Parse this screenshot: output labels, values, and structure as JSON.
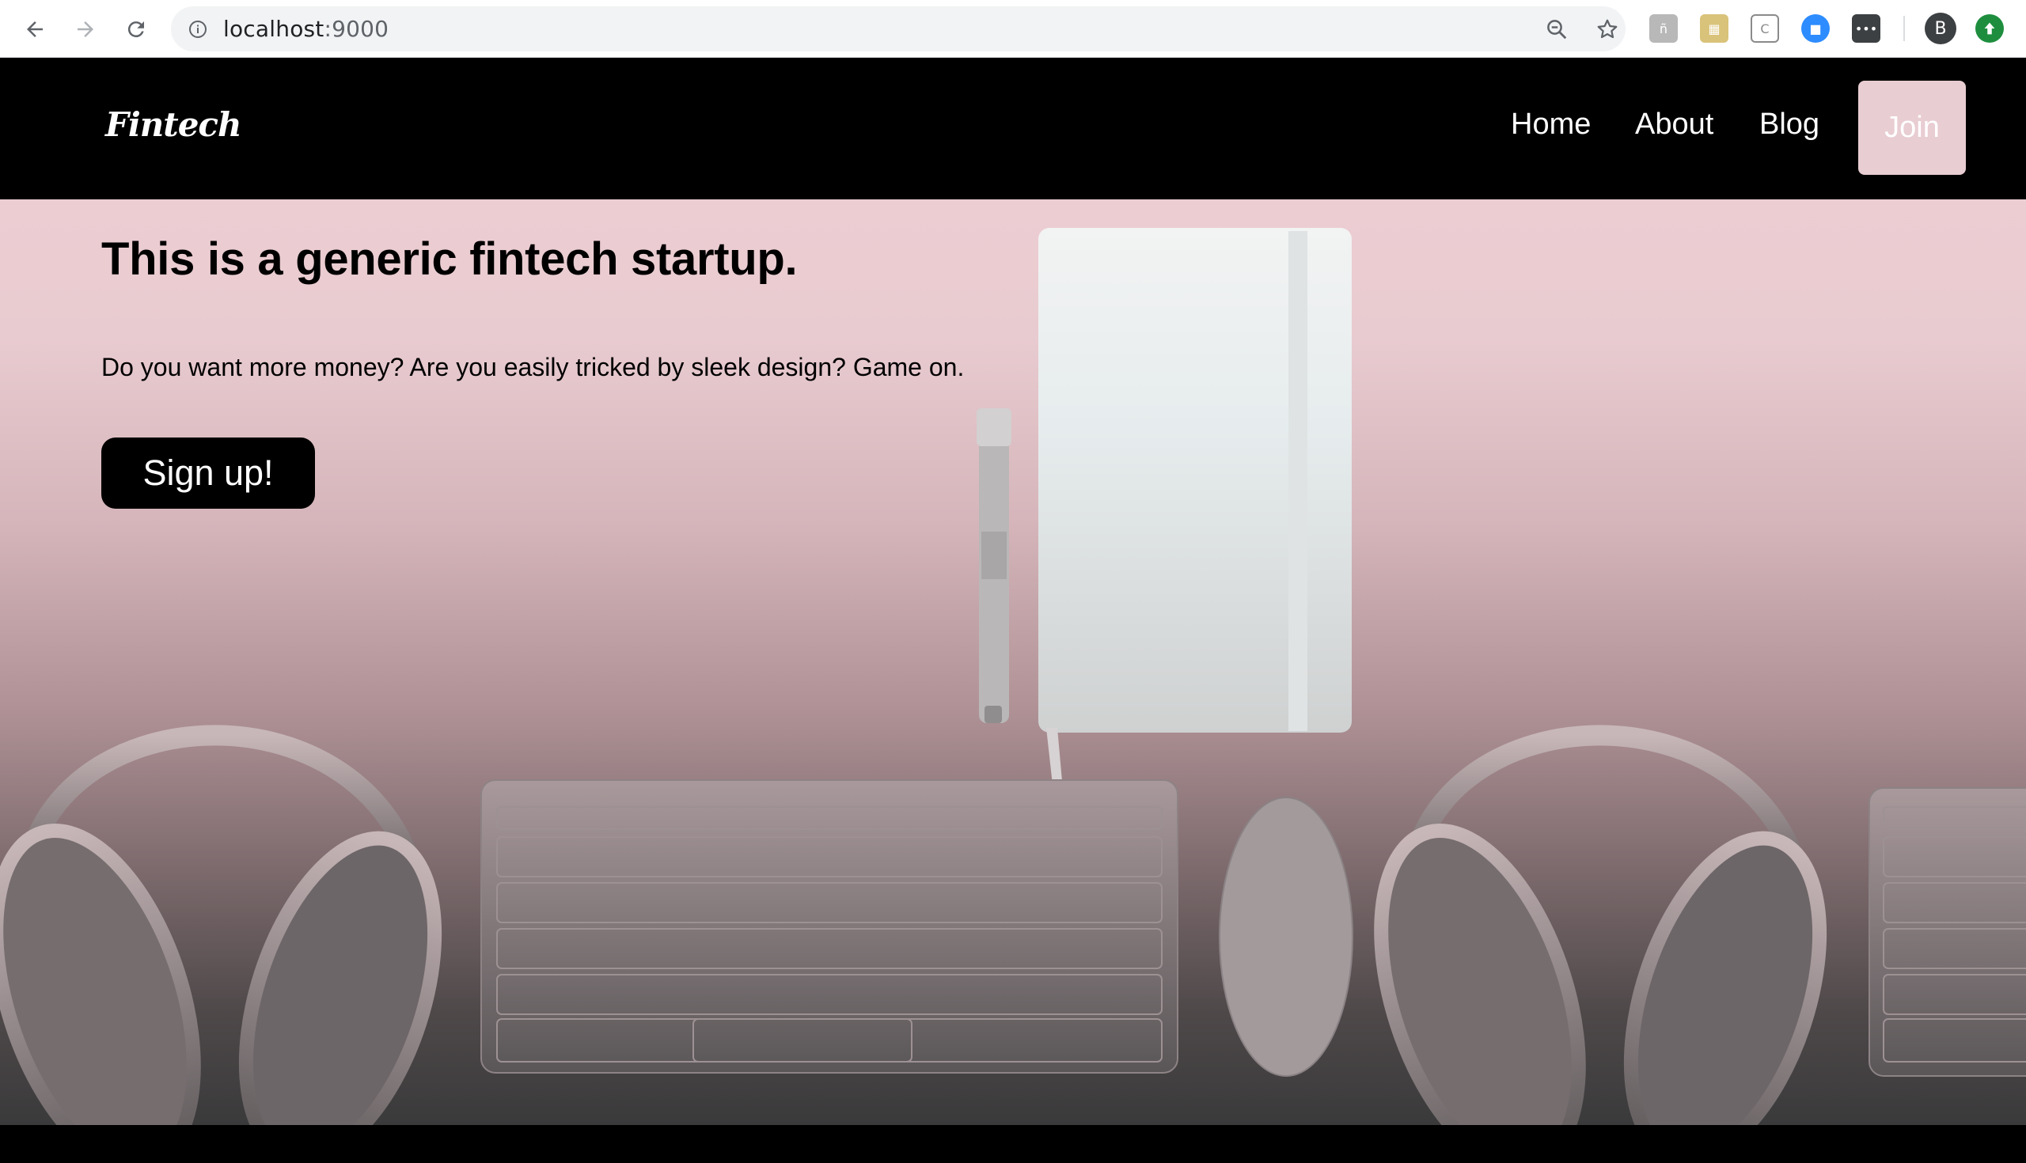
{
  "browser": {
    "url_host": "localhost",
    "url_port": ":9000",
    "profile_initial": "B",
    "icons": [
      "back-icon",
      "forward-icon",
      "reload-icon",
      "info-icon",
      "zoom-icon",
      "star-icon",
      "extension-icons",
      "update-icon"
    ]
  },
  "site": {
    "logo": "Fintech",
    "nav": {
      "home": "Home",
      "about": "About",
      "blog": "Blog",
      "join": "Join"
    },
    "colors": {
      "accent": "#e8cdd2",
      "header_bg": "#000000"
    }
  },
  "hero": {
    "title": "This is a generic fintech startup.",
    "subtitle": "Do you want more money? Are you easily tricked by sleek design? Game on.",
    "cta": "Sign up!"
  }
}
